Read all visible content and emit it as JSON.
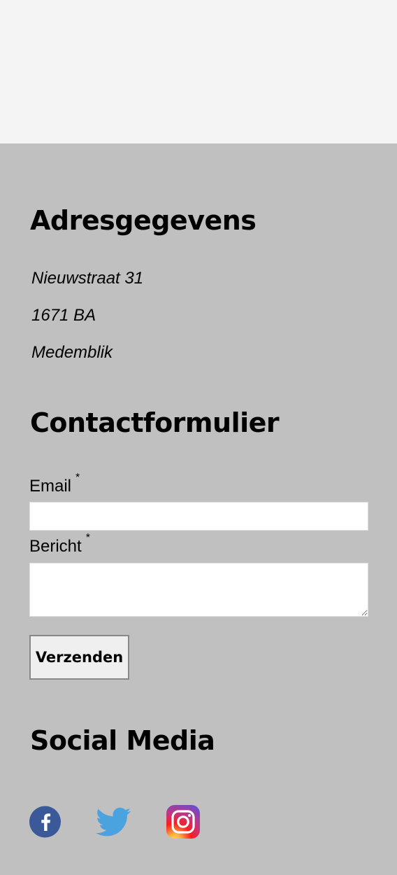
{
  "address_section": {
    "title": "Adresgegevens",
    "street": "Nieuwstraat 31",
    "postal_code": "1671 BA",
    "city": "Medemblik"
  },
  "contact_section": {
    "title": "Contactformulier",
    "email_label": "Email",
    "message_label": "Bericht",
    "required_marker": "*",
    "email_value": "",
    "message_value": "",
    "submit_label": "Verzenden"
  },
  "social_section": {
    "title": "Social Media",
    "links": [
      {
        "name": "facebook",
        "icon": "facebook-icon",
        "color": "#3b5998"
      },
      {
        "name": "twitter",
        "icon": "twitter-icon",
        "color": "#4aa3df"
      },
      {
        "name": "instagram",
        "icon": "instagram-icon",
        "color": "#c13584"
      }
    ]
  },
  "colors": {
    "top_band": "#f4f4f4",
    "footer_background": "#c0c0c0",
    "input_background": "#ffffff",
    "button_background": "#efefef"
  }
}
